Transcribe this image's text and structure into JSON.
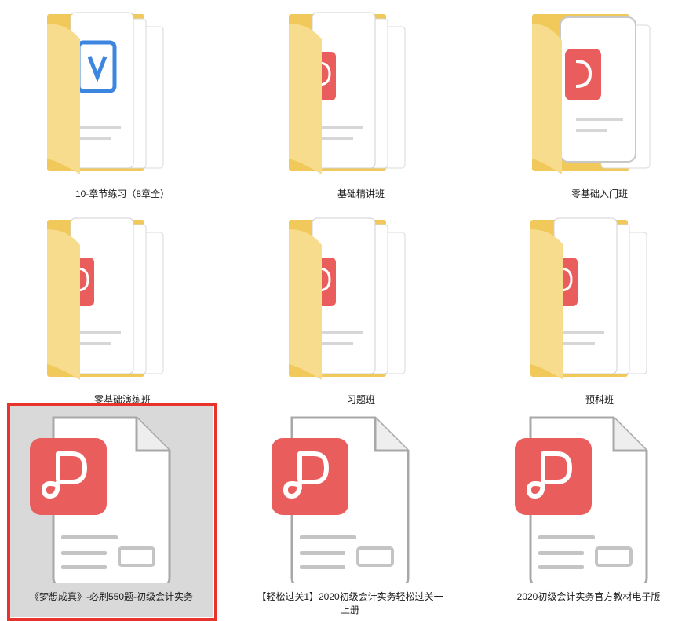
{
  "colors": {
    "folder_back": "#f0c95a",
    "folder_front": "#f7dc8e",
    "pdf_red": "#e95e5c",
    "selection": "#e8322b",
    "selection_bg": "#d9d9d9"
  },
  "items": [
    {
      "label": "10-章节练习（8章全）",
      "type": "folder",
      "preview": "word"
    },
    {
      "label": "基础精讲班",
      "type": "folder",
      "preview": "pdf"
    },
    {
      "label": "零基础入门班",
      "type": "folder",
      "preview": "pdf"
    },
    {
      "label": "零基础演练班",
      "type": "folder",
      "preview": "pdf"
    },
    {
      "label": "习题班",
      "type": "folder",
      "preview": "pdf"
    },
    {
      "label": "预科班",
      "type": "folder",
      "preview": "pdf"
    },
    {
      "label": "《梦想成真》-必刷550题-初级会计实务",
      "type": "pdf",
      "selected": true
    },
    {
      "label": "【轻松过关1】2020初级会计实务轻松过关一上册",
      "type": "pdf"
    },
    {
      "label": "2020初级会计实务官方教材电子版",
      "type": "pdf"
    }
  ]
}
